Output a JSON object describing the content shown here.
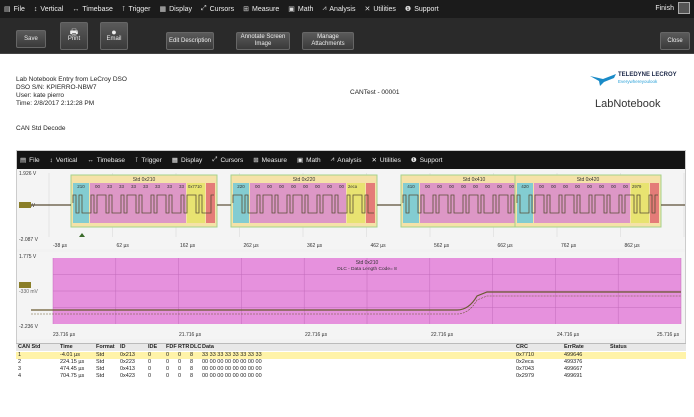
{
  "menu": {
    "items": [
      {
        "label": "File",
        "icon": "file-icon",
        "glyph": "▤"
      },
      {
        "label": "Vertical",
        "icon": "vertical-icon",
        "glyph": "↕"
      },
      {
        "label": "Timebase",
        "icon": "timebase-icon",
        "glyph": "↔"
      },
      {
        "label": "Trigger",
        "icon": "trigger-icon",
        "glyph": "⊺"
      },
      {
        "label": "Display",
        "icon": "display-icon",
        "glyph": "▦"
      },
      {
        "label": "Cursors",
        "icon": "cursors-icon",
        "glyph": "⤢"
      },
      {
        "label": "Measure",
        "icon": "measure-icon",
        "glyph": "⊞"
      },
      {
        "label": "Math",
        "icon": "math-icon",
        "glyph": "▣"
      },
      {
        "label": "Analysis",
        "icon": "analysis-icon",
        "glyph": "⩘"
      },
      {
        "label": "Utilities",
        "icon": "utilities-icon",
        "glyph": "✕"
      },
      {
        "label": "Support",
        "icon": "support-icon",
        "glyph": "❶"
      }
    ],
    "finish_label": "Finish"
  },
  "toolbar": {
    "save": "Save",
    "print": "Print",
    "email": "Email",
    "edit_description": "Edit Description",
    "annotate": "Annotate Screen Image",
    "manage": "Manage Attachments",
    "close": "Close"
  },
  "doc": {
    "line1": "Lab Notebook Entry from LeCroy DSO",
    "line2": "DSO S/N: KPIERRO-NBW7",
    "line3": "User: kate pierro",
    "line4": "Time: 2/8/2017 2:12:28 PM",
    "center": "CANTest - 00001",
    "decode": "CAN Std Decode",
    "brand": "TELEDYNE LECROY",
    "tagline": "Everywhereyoulook",
    "notebook": "LabNotebook"
  },
  "scope_menu": {
    "items": [
      "File",
      "Vertical",
      "Timebase",
      "Trigger",
      "Display",
      "Cursors",
      "Measure",
      "Math",
      "Analysis",
      "Utilities",
      "Support"
    ]
  },
  "plot1": {
    "ytop": "1.926 V",
    "ymid": "-89 mV",
    "ybot": "-2.087 V",
    "xticks": [
      "-38 µs",
      "62 µs",
      "162 µs",
      "262 µs",
      "362 µs",
      "462 µs",
      "562 µs",
      "662 µs",
      "762 µs",
      "862 µs",
      "962 µs"
    ],
    "frames": [
      {
        "label": "Std 0x210",
        "id_text": "210",
        "data": [
          "00",
          "33",
          "33",
          "33",
          "33",
          "33",
          "33",
          "33"
        ],
        "crc": "0x7710"
      },
      {
        "label": "Std 0x220",
        "id_text": "220",
        "data": [
          "00",
          "00",
          "00",
          "00",
          "00",
          "00",
          "00",
          "00"
        ],
        "crc": "2eca"
      },
      {
        "label": "Std 0x410",
        "id_text": "410",
        "data": [
          "00",
          "00",
          "00",
          "00",
          "00",
          "00",
          "00",
          "00"
        ],
        "crc": "0x7043"
      },
      {
        "label": "Std 0x420",
        "id_text": "420",
        "data": [
          "00",
          "00",
          "00",
          "00",
          "00",
          "00",
          "00",
          "00"
        ],
        "crc": "2979"
      }
    ]
  },
  "plot2": {
    "ytop": "1.775 V",
    "ymid": "-330 mV",
    "ybot": "-2.236 V",
    "frame_label": "Std 0x210",
    "frame_sub": "DLC - Data Length Code= 8",
    "xticks": [
      "23.716 µs",
      "21.716 µs",
      "22.716 µs",
      "22.716 µs",
      "24.716 µs",
      "25.716 µs"
    ]
  },
  "table": {
    "headers": [
      "CAN Std",
      "Time",
      "Format",
      "ID",
      "IDE",
      "FDF",
      "RTR",
      "DLC",
      "Data",
      "CRC",
      "ErrRate",
      "Status"
    ],
    "rows": [
      [
        "1",
        "-4.01 µs",
        "Std",
        "0x213",
        "0",
        "0",
        "0",
        "8",
        "33 33 33 33 33 33 33 33",
        "0x7710",
        "499646",
        ""
      ],
      [
        "2",
        "224.15 µs",
        "Std",
        "0x223",
        "0",
        "0",
        "0",
        "8",
        "00 00 00 00 00 00 00 00",
        "0x2eca",
        "499376",
        ""
      ],
      [
        "3",
        "474.45 µs",
        "Std",
        "0x413",
        "0",
        "0",
        "0",
        "8",
        "00 00 00 00 00 00 00 00",
        "0x7043",
        "499667",
        ""
      ],
      [
        "4",
        "704.75 µs",
        "Std",
        "0x423",
        "0",
        "0",
        "0",
        "8",
        "00 00 00 00 00 00 00 00",
        "0x2979",
        "499691",
        ""
      ]
    ]
  },
  "colors": {
    "menubar": "#1b1b1b",
    "frame_bg": "#f5e2a8",
    "frame_border": "#a5d28a",
    "id_field": "#6ec8d8",
    "data_field": "#d88acb",
    "crc_field": "#e7e36a",
    "eof_field": "#e06a70",
    "trace": "#5a4e36",
    "plot2_band": "#e37fd8"
  }
}
